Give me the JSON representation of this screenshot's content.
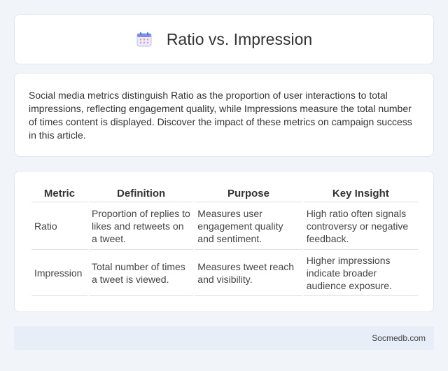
{
  "header": {
    "icon": "calendar-icon",
    "title": "Ratio vs. Impression"
  },
  "intro": {
    "text": "Social media metrics distinguish Ratio as the proportion of user interactions to total impressions, reflecting engagement quality, while Impressions measure the total number of times content is displayed. Discover the impact of these metrics on campaign success in this article."
  },
  "table": {
    "headers": [
      "Metric",
      "Definition",
      "Purpose",
      "Key Insight"
    ],
    "rows": [
      {
        "metric": "Ratio",
        "definition": "Proportion of replies to likes and retweets on a tweet.",
        "purpose": "Measures user engagement quality and sentiment.",
        "insight": "High ratio often signals controversy or negative feedback."
      },
      {
        "metric": "Impression",
        "definition": "Total number of times a tweet is viewed.",
        "purpose": "Measures tweet reach and visibility.",
        "insight": "Higher impressions indicate broader audience exposure."
      }
    ]
  },
  "footer": {
    "text": "Socmedb.com"
  },
  "colors": {
    "background": "#f1f4f9",
    "card": "#ffffff",
    "footer": "#e8eef8",
    "icon_accent": "#7b8fe8"
  }
}
